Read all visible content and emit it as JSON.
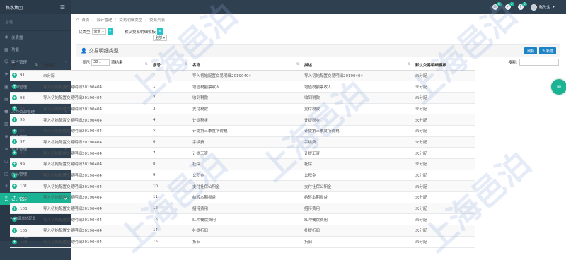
{
  "brand": {
    "name": "格水集团",
    "toggle_icon": "hamburger-icon"
  },
  "user_strip": "合格",
  "sidebar": {
    "items": [
      {
        "label": "仪表盘",
        "icon": "dashboard-icon"
      },
      {
        "label": "功能",
        "icon": "grid-icon"
      },
      {
        "label": "客户管理",
        "icon": "users-icon"
      },
      {
        "label": "供应管理",
        "icon": "truck-icon"
      },
      {
        "label": "公司管理",
        "icon": "building-icon"
      },
      {
        "label": "合同管理",
        "icon": "file-icon"
      },
      {
        "label": "人力资源管理",
        "icon": "person-icon"
      },
      {
        "label": "合同管理",
        "icon": "doc-icon"
      },
      {
        "label": "采购管理",
        "icon": "cart-icon"
      },
      {
        "label": "订单管理",
        "icon": "list-icon"
      },
      {
        "label": "项目管理",
        "icon": "folder-icon"
      },
      {
        "label": "产品管理",
        "icon": "box-icon"
      },
      {
        "label": "财务管理",
        "icon": "money-icon"
      },
      {
        "label": "会计管理",
        "icon": "calc-icon",
        "active": true
      }
    ],
    "sub_items": [
      {
        "label": "法人维护"
      },
      {
        "label": "资源单位配置"
      },
      {
        "label": "凭证汇率"
      },
      {
        "label": "交易类型"
      }
    ]
  },
  "topbar": {
    "icons": [
      {
        "name": "message-icon",
        "badge": "8",
        "label": "消息"
      },
      {
        "name": "task-icon",
        "badge": "2",
        "label": "任务"
      },
      {
        "name": "notice-icon",
        "badge": "0",
        "label": "通知"
      }
    ],
    "user_name": "赵先生"
  },
  "breadcrumb": [
    "首页",
    "会计管理",
    "交易明细类型",
    "交易列表"
  ],
  "filters": {
    "parent_type_label": "父类型",
    "parent_type_value": "全部",
    "template_label": "默认交易明细模板",
    "template_value": "全部"
  },
  "panel": {
    "title": "交易明细类型",
    "title_icon": "user-icon",
    "btn_refresh": "刷新",
    "btn_new": "新建"
  },
  "toolbar": {
    "show_label": "显示",
    "page_size": "30",
    "unit_label": "项结果",
    "search_label": "搜索:"
  },
  "table": {
    "columns": [
      "ID",
      "父类型",
      "序号",
      "名称",
      "描述",
      "默认交易明细模板"
    ],
    "rows": [
      [
        "91",
        "未分配",
        "1",
        "导入初始配置交易明细20190404",
        "导入初始配置交易明细20190404",
        "未分配"
      ],
      [
        "92",
        "导入初始配置交易明细20190404",
        "1",
        "增值税额票收入",
        "增值税额票收入",
        "未分配"
      ],
      [
        "93",
        "导入初始配置交易明细20190404",
        "2",
        "收到税款",
        "收到税款",
        "未分配"
      ],
      [
        "94",
        "导入初始配置交易明细20190404",
        "3",
        "支付税款",
        "支付税款",
        "未分配"
      ],
      [
        "95",
        "导入初始配置交易明细20190404",
        "4",
        "计提税金",
        "计提税金",
        "未分配"
      ],
      [
        "96",
        "导入初始配置交易明细20190404",
        "5",
        "计提第三季度所得税",
        "计提第三季度所得税",
        "未分配"
      ],
      [
        "97",
        "导入初始配置交易明细20190404",
        "6",
        "手续费",
        "手续费",
        "未分配"
      ],
      [
        "98",
        "导入初始配置交易明细20190404",
        "7",
        "计提工资",
        "计提工资",
        "未分配"
      ],
      [
        "99",
        "导入初始配置交易明细20190404",
        "8",
        "社保",
        "社保",
        "未分配"
      ],
      [
        "100",
        "导入初始配置交易明细20190404",
        "9",
        "公积金",
        "公积金",
        "未分配"
      ],
      [
        "101",
        "导入初始配置交易明细20190404",
        "10",
        "支付社保公积金",
        "支付社保公积金",
        "未分配"
      ],
      [
        "102",
        "导入初始配置交易明细20190404",
        "11",
        "结转本期损益",
        "结转本期损益",
        "未分配"
      ],
      [
        "103",
        "导入初始配置交易明细20190404",
        "12",
        "招待费用",
        "招待费用",
        "未分配"
      ],
      [
        "104",
        "导入初始配置交易明细20190404",
        "13",
        "红冲餐饮费用",
        "红冲餐饮费用",
        "未分配"
      ],
      [
        "105",
        "导入初始配置交易明细20190404",
        "14",
        "补提折旧",
        "补提折旧",
        "未分配"
      ],
      [
        "106",
        "导入初始配置交易明细20190404",
        "15",
        "折旧",
        "折旧",
        "未分配"
      ]
    ]
  },
  "watermark": "上海邑泊",
  "colors": {
    "sidebar": "#2f4050",
    "accent": "#1ab394",
    "button": "#1c84c6"
  }
}
